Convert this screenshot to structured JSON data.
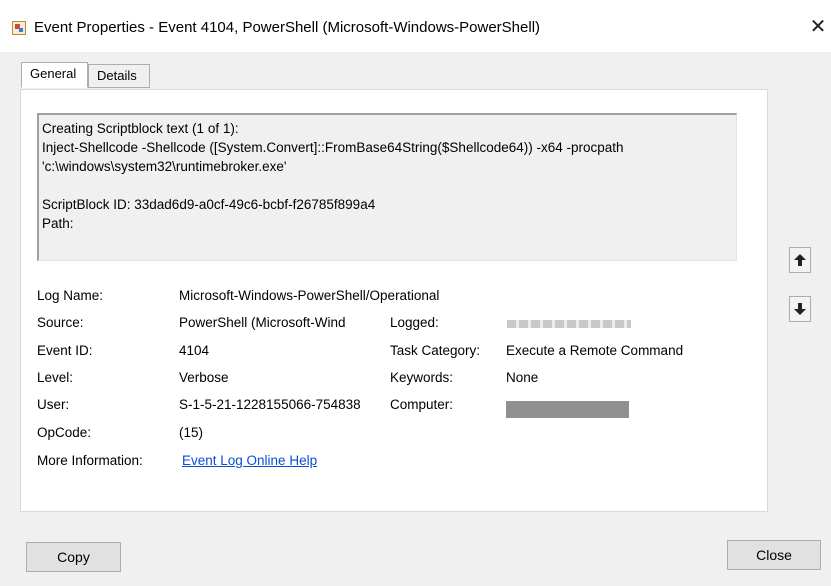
{
  "window": {
    "title": "Event Properties - Event 4104, PowerShell (Microsoft-Windows-PowerShell)",
    "icon": "event-viewer-icon",
    "close_glyph": "✕"
  },
  "tabs": [
    {
      "label": "General",
      "active": true
    },
    {
      "label": "Details",
      "active": false
    }
  ],
  "script_text": {
    "line1": "Creating Scriptblock text (1 of 1):",
    "line2": "Inject-Shellcode -Shellcode ([System.Convert]::FromBase64String($Shellcode64)) -x64 -procpath",
    "line3": "'c:\\windows\\system32\\runtimebroker.exe'",
    "line4": "ScriptBlock ID: 33dad6d9-a0cf-49c6-bcbf-f26785f899a4",
    "line5": "Path:"
  },
  "fields": {
    "log_name_label": "Log Name:",
    "log_name_value": "Microsoft-Windows-PowerShell/Operational",
    "source_label": "Source:",
    "source_value": "PowerShell (Microsoft-Wind",
    "logged_label": "Logged:",
    "event_id_label": "Event ID:",
    "event_id_value": "4104",
    "task_category_label": "Task Category:",
    "task_category_value": "Execute a Remote Command",
    "level_label": "Level:",
    "level_value": "Verbose",
    "keywords_label": "Keywords:",
    "keywords_value": "None",
    "user_label": "User:",
    "user_value": "S-1-5-21-1228155066-754838",
    "computer_label": "Computer:",
    "opcode_label": "OpCode:",
    "opcode_value": "(15)",
    "more_info_label": "More Information:",
    "more_info_link": "Event Log Online Help"
  },
  "buttons": {
    "copy": "Copy",
    "close": "Close",
    "up_icon": "arrow-up-icon",
    "down_icon": "arrow-down-icon"
  }
}
